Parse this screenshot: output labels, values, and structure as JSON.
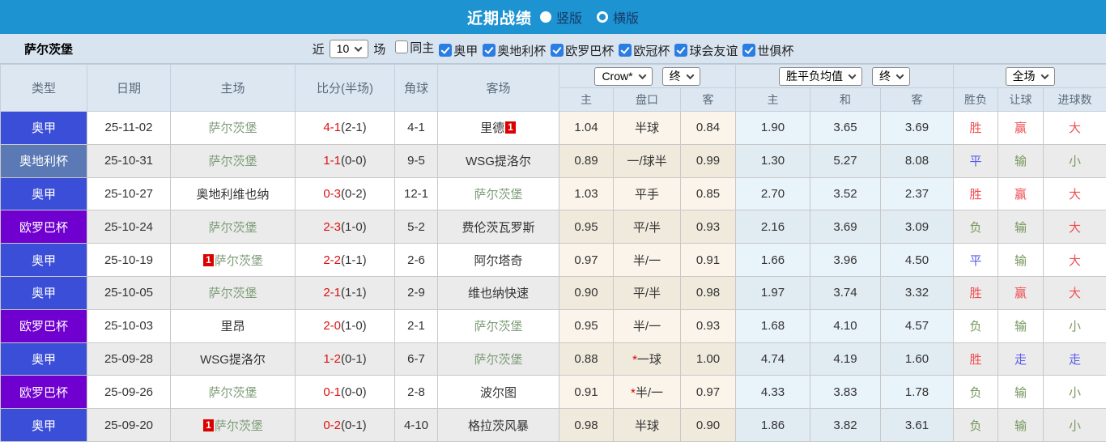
{
  "topbar": {
    "title": "近期战绩",
    "radios": [
      {
        "label": "竖版",
        "selected": true
      },
      {
        "label": "横版",
        "selected": false
      }
    ]
  },
  "filterbar": {
    "team": "萨尔茨堡",
    "near_label": "近",
    "count_value": "10",
    "matches_label": "场",
    "checkboxes": [
      {
        "label": "同主",
        "checked": false
      },
      {
        "label": "奥甲",
        "checked": true
      },
      {
        "label": "奥地利杯",
        "checked": true
      },
      {
        "label": "欧罗巴杯",
        "checked": true
      },
      {
        "label": "欧冠杯",
        "checked": true
      },
      {
        "label": "球会友谊",
        "checked": true
      },
      {
        "label": "世俱杯",
        "checked": true
      }
    ]
  },
  "table": {
    "headers": {
      "type": "类型",
      "date": "日期",
      "home": "主场",
      "score": "比分(半场)",
      "corners": "角球",
      "away": "客场",
      "dropdowns": {
        "bookmaker": "Crow*",
        "final1": "终",
        "avg": "胜平负均值",
        "final2": "终",
        "scope": "全场"
      },
      "sub": {
        "home_odds": "主",
        "handicap": "盘口",
        "away_odds": "客",
        "avg_home": "主",
        "avg_draw": "和",
        "avg_away": "客",
        "wdl": "胜负",
        "handicap_result": "让球",
        "goals": "进球数"
      }
    },
    "rows": [
      {
        "type": "奥甲",
        "date": "25-11-02",
        "home": "萨尔茨堡",
        "home_badge": "",
        "home_badge_pos": "",
        "score": "4-1",
        "half": "2-1",
        "corners": "4-1",
        "away": "里德",
        "away_badge": "1",
        "away_badge_pos": "after",
        "crow_home": "1.04",
        "handicap": "半球",
        "crow_away": "0.84",
        "avg_home": "1.90",
        "avg_draw": "3.65",
        "avg_away": "3.69",
        "wdl": "胜",
        "rq": "赢",
        "jq": "大"
      },
      {
        "type": "奥地利杯",
        "date": "25-10-31",
        "home": "萨尔茨堡",
        "home_badge": "",
        "home_badge_pos": "",
        "score": "1-1",
        "half": "0-0",
        "corners": "9-5",
        "away": "WSG提洛尔",
        "away_badge": "",
        "away_badge_pos": "",
        "crow_home": "0.89",
        "handicap": "一/球半",
        "crow_away": "0.99",
        "avg_home": "1.30",
        "avg_draw": "5.27",
        "avg_away": "8.08",
        "wdl": "平",
        "rq": "输",
        "jq": "小"
      },
      {
        "type": "奥甲",
        "date": "25-10-27",
        "home": "奥地利维也纳",
        "home_badge": "",
        "home_badge_pos": "",
        "score": "0-3",
        "half": "0-2",
        "corners": "12-1",
        "away": "萨尔茨堡",
        "away_badge": "",
        "away_badge_pos": "",
        "crow_home": "1.03",
        "handicap": "平手",
        "crow_away": "0.85",
        "avg_home": "2.70",
        "avg_draw": "3.52",
        "avg_away": "2.37",
        "wdl": "胜",
        "rq": "赢",
        "jq": "大"
      },
      {
        "type": "欧罗巴杯",
        "date": "25-10-24",
        "home": "萨尔茨堡",
        "home_badge": "",
        "home_badge_pos": "",
        "score": "2-3",
        "half": "1-0",
        "corners": "5-2",
        "away": "费伦茨瓦罗斯",
        "away_badge": "",
        "away_badge_pos": "",
        "crow_home": "0.95",
        "handicap": "平/半",
        "crow_away": "0.93",
        "avg_home": "2.16",
        "avg_draw": "3.69",
        "avg_away": "3.09",
        "wdl": "负",
        "rq": "输",
        "jq": "大"
      },
      {
        "type": "奥甲",
        "date": "25-10-19",
        "home": "萨尔茨堡",
        "home_badge": "1",
        "home_badge_pos": "before",
        "score": "2-2",
        "half": "1-1",
        "corners": "2-6",
        "away": "阿尔塔奇",
        "away_badge": "",
        "away_badge_pos": "",
        "crow_home": "0.97",
        "handicap": "半/一",
        "crow_away": "0.91",
        "avg_home": "1.66",
        "avg_draw": "3.96",
        "avg_away": "4.50",
        "wdl": "平",
        "rq": "输",
        "jq": "大"
      },
      {
        "type": "奥甲",
        "date": "25-10-05",
        "home": "萨尔茨堡",
        "home_badge": "",
        "home_badge_pos": "",
        "score": "2-1",
        "half": "1-1",
        "corners": "2-9",
        "away": "维也纳快速",
        "away_badge": "",
        "away_badge_pos": "",
        "crow_home": "0.90",
        "handicap": "平/半",
        "crow_away": "0.98",
        "avg_home": "1.97",
        "avg_draw": "3.74",
        "avg_away": "3.32",
        "wdl": "胜",
        "rq": "赢",
        "jq": "大"
      },
      {
        "type": "欧罗巴杯",
        "date": "25-10-03",
        "home": "里昂",
        "home_badge": "",
        "home_badge_pos": "",
        "score": "2-0",
        "half": "1-0",
        "corners": "2-1",
        "away": "萨尔茨堡",
        "away_badge": "",
        "away_badge_pos": "",
        "crow_home": "0.95",
        "handicap": "半/一",
        "crow_away": "0.93",
        "avg_home": "1.68",
        "avg_draw": "4.10",
        "avg_away": "4.57",
        "wdl": "负",
        "rq": "输",
        "jq": "小"
      },
      {
        "type": "奥甲",
        "date": "25-09-28",
        "home": "WSG提洛尔",
        "home_badge": "",
        "home_badge_pos": "",
        "score": "1-2",
        "half": "0-1",
        "corners": "6-7",
        "away": "萨尔茨堡",
        "away_badge": "",
        "away_badge_pos": "",
        "crow_home": "0.88",
        "handicap": "*一球",
        "crow_away": "1.00",
        "avg_home": "4.74",
        "avg_draw": "4.19",
        "avg_away": "1.60",
        "wdl": "胜",
        "rq": "走",
        "jq": "走"
      },
      {
        "type": "欧罗巴杯",
        "date": "25-09-26",
        "home": "萨尔茨堡",
        "home_badge": "",
        "home_badge_pos": "",
        "score": "0-1",
        "half": "0-0",
        "corners": "2-8",
        "away": "波尔图",
        "away_badge": "",
        "away_badge_pos": "",
        "crow_home": "0.91",
        "handicap": "*半/一",
        "crow_away": "0.97",
        "avg_home": "4.33",
        "avg_draw": "3.83",
        "avg_away": "1.78",
        "wdl": "负",
        "rq": "输",
        "jq": "小"
      },
      {
        "type": "奥甲",
        "date": "25-09-20",
        "home": "萨尔茨堡",
        "home_badge": "1",
        "home_badge_pos": "before",
        "score": "0-2",
        "half": "0-1",
        "corners": "4-10",
        "away": "格拉茨风暴",
        "away_badge": "",
        "away_badge_pos": "",
        "crow_home": "0.98",
        "handicap": "半球",
        "crow_away": "0.90",
        "avg_home": "1.86",
        "avg_draw": "3.82",
        "avg_away": "3.61",
        "wdl": "负",
        "rq": "输",
        "jq": "小"
      }
    ]
  },
  "colors": {
    "topbar_bg": "#1d93d2",
    "league_blue": "#3b4ed8",
    "cup_steel": "#5b79b4",
    "uel_purple": "#7000d0",
    "self_green": "#7d9d77",
    "score_red": "#dd1111",
    "win_red": "#ef4e53",
    "lose_green": "#76975c",
    "draw_blue": "#5b5bee"
  }
}
